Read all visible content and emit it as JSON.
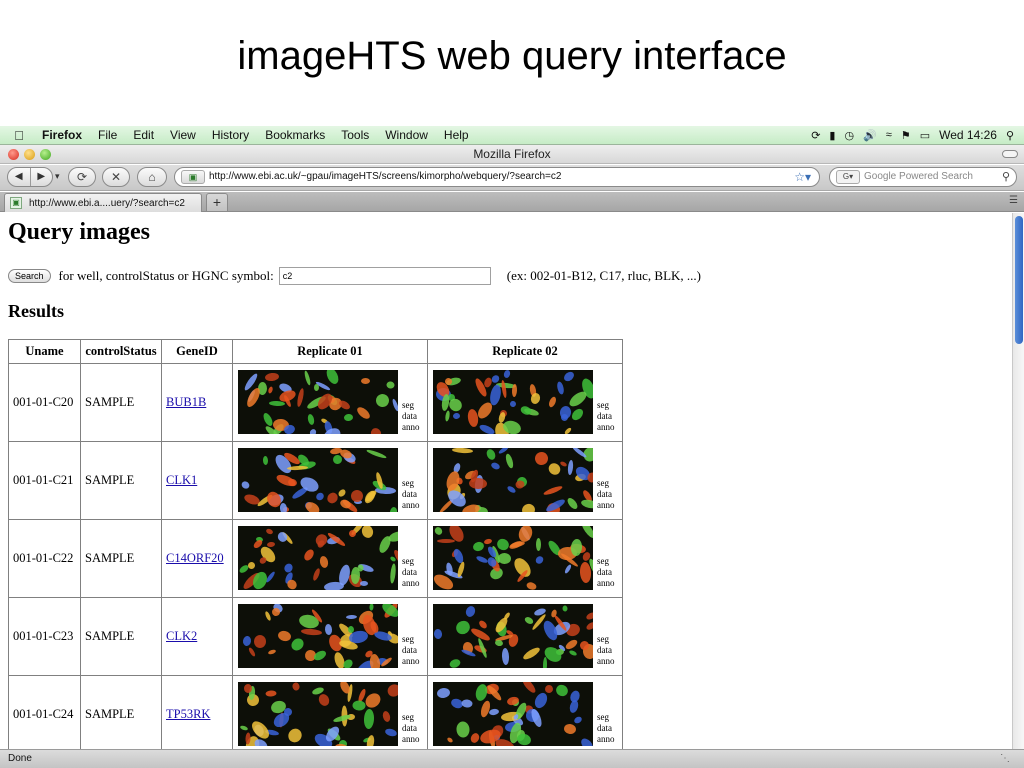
{
  "slide": {
    "title": "imageHTS web query interface"
  },
  "menubar": {
    "app_name": "Firefox",
    "items": [
      "File",
      "Edit",
      "View",
      "History",
      "Bookmarks",
      "Tools",
      "Window",
      "Help"
    ],
    "clock": "Wed 14:26"
  },
  "window": {
    "title": "Mozilla Firefox"
  },
  "toolbar": {
    "url": "http://www.ebi.ac.uk/~gpau/imageHTS/screens/kimorpho/webquery/?search=c2",
    "search_placeholder": "Google Powered Search"
  },
  "tab": {
    "label": "http://www.ebi.a....uery/?search=c2"
  },
  "page": {
    "heading": "Query images",
    "search_button": "Search",
    "search_label": "for well, controlStatus or HGNC symbol:",
    "search_value": "c2",
    "search_hint": "(ex: 002-01-B12, C17, rluc, BLK, ...)",
    "results_heading": "Results",
    "columns": [
      "Uname",
      "controlStatus",
      "GeneID",
      "Replicate 01",
      "Replicate 02"
    ],
    "image_links": [
      "seg",
      "data",
      "anno"
    ],
    "rows": [
      {
        "uname": "001-01-C20",
        "status": "SAMPLE",
        "gene": "BUB1B"
      },
      {
        "uname": "001-01-C21",
        "status": "SAMPLE",
        "gene": "CLK1"
      },
      {
        "uname": "001-01-C22",
        "status": "SAMPLE",
        "gene": "C14ORF20"
      },
      {
        "uname": "001-01-C23",
        "status": "SAMPLE",
        "gene": "CLK2"
      },
      {
        "uname": "001-01-C24",
        "status": "SAMPLE",
        "gene": "TP53RK"
      }
    ]
  },
  "statusbar": {
    "text": "Done"
  },
  "colors": {
    "menubar": "#c6ecc6",
    "link": "#1a0dab",
    "scroll_thumb": "#2f66c3"
  }
}
